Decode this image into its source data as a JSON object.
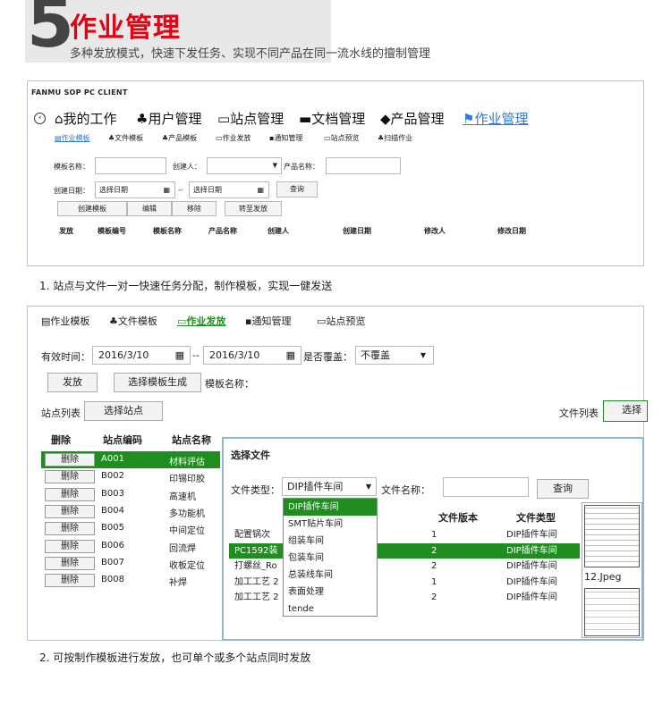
{
  "header": {
    "number": "5",
    "title": "作业管理",
    "subtitle": "多种发放模式，快速下发任务、实现不同产品在同一流水线的擅制管理"
  },
  "panel1": {
    "app_name": "FANMU SOP PC CLIENT",
    "main_menu": [
      "我的工作",
      "用户管理",
      "站点管理",
      "文档管理",
      "产品管理",
      "作业管理"
    ],
    "sub_tabs": [
      "作业模板",
      "文件模板",
      "产品模板",
      "作业发放",
      "通知管理",
      "站点预览",
      "扫描作业"
    ],
    "form": {
      "template_name_label": "模板名称：",
      "creator_label": "创建人：",
      "product_name_label": "产品名称：",
      "create_date_label": "创建日期：",
      "date_placeholder": "选择日期",
      "date_sep": "--",
      "query_btn": "查询"
    },
    "buttons": [
      "创建模板",
      "编辑",
      "移除",
      "转至发放"
    ],
    "columns": [
      "发放",
      "模板编号",
      "模板名称",
      "产品名称",
      "创建人",
      "创建日期",
      "修改人",
      "修改日期"
    ]
  },
  "caption1": "1. 站点与文件一对一快速任务分配，制作模板，实现一健发送",
  "panel2": {
    "tabs": [
      "作业模板",
      "文件模板",
      "作业发放",
      "通知管理",
      "站点预览"
    ],
    "effective_label": "有效时间：",
    "date_from": "2016/3/10",
    "date_sep": "--",
    "date_to": "2016/3/10",
    "overwrite_label": "是否覆盖：",
    "overwrite_value": "不覆盖",
    "issue_btn": "发放",
    "select_template_btn": "选择模板生成",
    "template_name_label": "模板名称：",
    "station_list_label": "站点列表",
    "select_station_btn": "选择站点",
    "file_list_label": "文件列表",
    "select_btn": "选择",
    "station_columns": [
      "删除",
      "站点编码",
      "站点名称"
    ],
    "del_label": "删除",
    "stations": [
      {
        "code": "A001",
        "name": "材料评估"
      },
      {
        "code": "B002",
        "name": "印锡印胶"
      },
      {
        "code": "B003",
        "name": "高速机"
      },
      {
        "code": "B004",
        "name": "多功能机"
      },
      {
        "code": "B005",
        "name": "中间定位"
      },
      {
        "code": "B006",
        "name": "回流焊"
      },
      {
        "code": "B007",
        "name": "收板定位"
      },
      {
        "code": "B008",
        "name": "补焊"
      }
    ]
  },
  "dialog": {
    "title": "选择文件",
    "file_type_label": "文件类型：",
    "file_type_value": "DIP插件车间",
    "file_name_label": "文件名称：",
    "query_btn": "查询",
    "columns": [
      "文件版本",
      "文件类型"
    ],
    "dropdown_options": [
      "DIP插件车间",
      "SMT贴片车间",
      "组装车间",
      "包装车间",
      "总装线车间",
      "表面处理",
      "tende"
    ],
    "rows": [
      {
        "name": "配置锅次",
        "version": "1",
        "type": "DIP插件车间"
      },
      {
        "name": "PC1592装",
        "version": "2",
        "type": "DIP插件车间"
      },
      {
        "name": "打螺丝_Ro",
        "version": "2",
        "type": "DIP插件车间"
      },
      {
        "name": "加工工艺 2",
        "version": "1",
        "type": "DIP插件车间"
      },
      {
        "name": "加工工艺 2",
        "version": "2",
        "type": "DIP插件车间"
      }
    ],
    "preview_file": "12.Jpeg"
  },
  "caption2": "2. 可按制作模板进行发放，也可单个或多个站点同时发放",
  "colors": {
    "accent_red": "#e60012",
    "accent_blue": "#2f7bd6",
    "select_green": "#1f8d1f"
  }
}
